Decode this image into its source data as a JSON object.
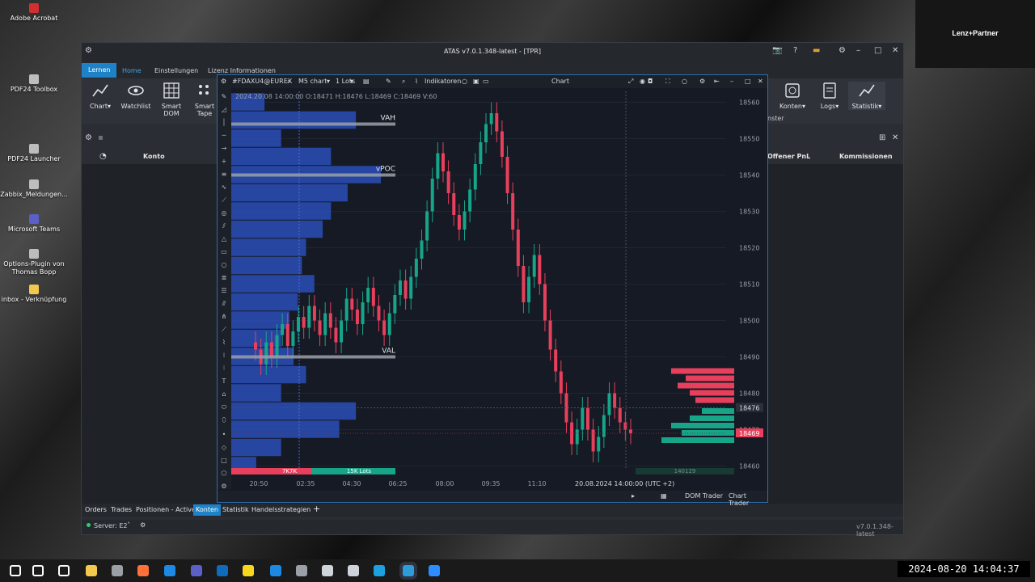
{
  "desktop": {
    "icons": [
      {
        "label": "Adobe Acrobat",
        "color": "#d32f2f"
      },
      {
        "label": "PDF24 Toolbox",
        "color": "#bdbdbd"
      },
      {
        "label": "PDF24 Launcher",
        "color": "#bdbdbd"
      },
      {
        "label": "Zabbix_Meldungen...",
        "color": "#bdbdbd"
      },
      {
        "label": "Microsoft Teams",
        "color": "#5b5fc7"
      },
      {
        "label": "Options-Plugin von Thomas Bopp",
        "color": "#bdbdbd"
      },
      {
        "label": "inbox - Verknüpfung",
        "color": "#f2c94c"
      }
    ],
    "corner_label": "Lenz+Partner"
  },
  "app": {
    "title": "ATAS v7.0.1.348-latest - [TPR]",
    "ribbon_tabs": [
      "Lernen",
      "Home",
      "Einstellungen",
      "Lizenz Informationen"
    ],
    "ribbon_buttons": [
      {
        "label": "Chart▾"
      },
      {
        "label": "Watchlist"
      },
      {
        "label": "Smart DOM"
      },
      {
        "label": "Smart Tape"
      }
    ],
    "ribbon_right_buttons": [
      {
        "label": "Konten▾"
      },
      {
        "label": "Logs▾"
      },
      {
        "label": "Statistik▾"
      }
    ],
    "ribbon_right_group": "nster",
    "columns": {
      "konto": "Konto",
      "offener_pnl": "Offener PnL",
      "kommissionen": "Kommissionen"
    },
    "bottom_tabs": [
      "Orders",
      "Trades",
      "Positionen - Active",
      "Konten",
      "Statistik",
      "Handelsstrategien"
    ],
    "active_bottom_tab": "Konten",
    "add_tab": "+",
    "server": "Server: E2",
    "version": "v7.0.1.348-latest"
  },
  "chart": {
    "symbol": "#FDAXU4@EUREX",
    "timeframe": "M5 chart",
    "lots": "1 Lots",
    "indicators": "Indikatoren",
    "window_title": "Chart",
    "info_line": "2024.20.08 14:00:00 O:18471 H:18476 L:18469 C:18469 V:60",
    "labels": {
      "vah": "VAH",
      "vpoc": "vPOC",
      "val": "VAL"
    },
    "volume_bar": {
      "left": "7K7K",
      "right": "15K Lots"
    },
    "bottom_right_value": "140129",
    "current_time": "20.08.2024  14:00:00 (UTC +2)",
    "footer": {
      "dom_trader": "DOM Trader",
      "chart_trader": "Chart Trader"
    },
    "price_labels": {
      "crosshair": "18476",
      "last": "18469"
    },
    "colors": {
      "up": "#17a589",
      "down": "#e8405c",
      "profile": "#2a4fb8",
      "price_tag": "#e8405c"
    }
  },
  "chart_data": {
    "type": "candlestick",
    "title": "",
    "xlabel": "",
    "ylabel": "",
    "x_ticks": [
      "20:50",
      "02:35",
      "04:30",
      "06:25",
      "08:00",
      "09:35",
      "11:10"
    ],
    "y_ticks": [
      18460,
      18470,
      18480,
      18490,
      18500,
      18510,
      18520,
      18530,
      18540,
      18550,
      18560
    ],
    "ylim": [
      18459,
      18563
    ],
    "levels": {
      "VAH": 18554,
      "vPOC": 18540,
      "VAL": 18490
    },
    "closes": [
      18492,
      18488,
      18494,
      18490,
      18496,
      18499,
      18493,
      18497,
      18501,
      18498,
      18504,
      18500,
      18496,
      18502,
      18498,
      18494,
      18500,
      18506,
      18503,
      18499,
      18505,
      18509,
      18504,
      18500,
      18496,
      18502,
      18507,
      18511,
      18506,
      18512,
      18517,
      18522,
      18530,
      18539,
      18546,
      18541,
      18535,
      18529,
      18525,
      18530,
      18536,
      18543,
      18549,
      18554,
      18557,
      18552,
      18545,
      18535,
      18525,
      18515,
      18505,
      18512,
      18518,
      18510,
      18500,
      18492,
      18486,
      18480,
      18472,
      18466,
      18470,
      18476,
      18470,
      18464,
      18468,
      18474,
      18480,
      18476,
      18472,
      18470,
      18469
    ],
    "volume_profile": [
      {
        "price": 18560,
        "volume": 40
      },
      {
        "price": 18555,
        "volume": 150
      },
      {
        "price": 18550,
        "volume": 60
      },
      {
        "price": 18545,
        "volume": 120
      },
      {
        "price": 18540,
        "volume": 180
      },
      {
        "price": 18535,
        "volume": 140
      },
      {
        "price": 18530,
        "volume": 120
      },
      {
        "price": 18525,
        "volume": 110
      },
      {
        "price": 18520,
        "volume": 90
      },
      {
        "price": 18515,
        "volume": 85
      },
      {
        "price": 18510,
        "volume": 100
      },
      {
        "price": 18505,
        "volume": 80
      },
      {
        "price": 18500,
        "volume": 70
      },
      {
        "price": 18495,
        "volume": 60
      },
      {
        "price": 18490,
        "volume": 75
      },
      {
        "price": 18485,
        "volume": 90
      },
      {
        "price": 18480,
        "volume": 60
      },
      {
        "price": 18475,
        "volume": 150
      },
      {
        "price": 18470,
        "volume": 130
      },
      {
        "price": 18465,
        "volume": 60
      },
      {
        "price": 18460,
        "volume": 30
      }
    ],
    "dom": {
      "asks": [
        {
          "price": 18486,
          "size": 78
        },
        {
          "price": 18484,
          "size": 60
        },
        {
          "price": 18482,
          "size": 70
        },
        {
          "price": 18480,
          "size": 55
        },
        {
          "price": 18478,
          "size": 48
        }
      ],
      "bids": [
        {
          "price": 18475,
          "size": 40
        },
        {
          "price": 18473,
          "size": 55
        },
        {
          "price": 18471,
          "size": 78
        },
        {
          "price": 18469,
          "size": 65
        },
        {
          "price": 18467,
          "size": 90
        }
      ]
    }
  },
  "taskbar": {
    "clock": "2024-08-20  14:04:37",
    "icons": [
      {
        "name": "start-icon",
        "color": "#ffffff"
      },
      {
        "name": "search-icon",
        "color": "#ffffff"
      },
      {
        "name": "task-view-icon",
        "color": "#ffffff"
      },
      {
        "name": "file-explorer-icon",
        "color": "#f2c94c"
      },
      {
        "name": "store-icon",
        "color": "#9aa0a6"
      },
      {
        "name": "firefox-icon",
        "color": "#ff7139"
      },
      {
        "name": "sky-icon",
        "color": "#1e88e5"
      },
      {
        "name": "teams-icon",
        "color": "#5b5fc7"
      },
      {
        "name": "outlook-icon",
        "color": "#0f6cbd"
      },
      {
        "name": "norton-icon",
        "color": "#f9d71c"
      },
      {
        "name": "network-icon",
        "color": "#1e88e5"
      },
      {
        "name": "mail-icon",
        "color": "#9aa0a6"
      },
      {
        "name": "filter-icon",
        "color": "#cfd3da"
      },
      {
        "name": "chat-icon",
        "color": "#cfd3da"
      },
      {
        "name": "edge-icon",
        "color": "#1ba1e2"
      },
      {
        "name": "atas-icon",
        "color": "#2d9cdb"
      },
      {
        "name": "zoom-icon",
        "color": "#2d8cff"
      }
    ]
  }
}
